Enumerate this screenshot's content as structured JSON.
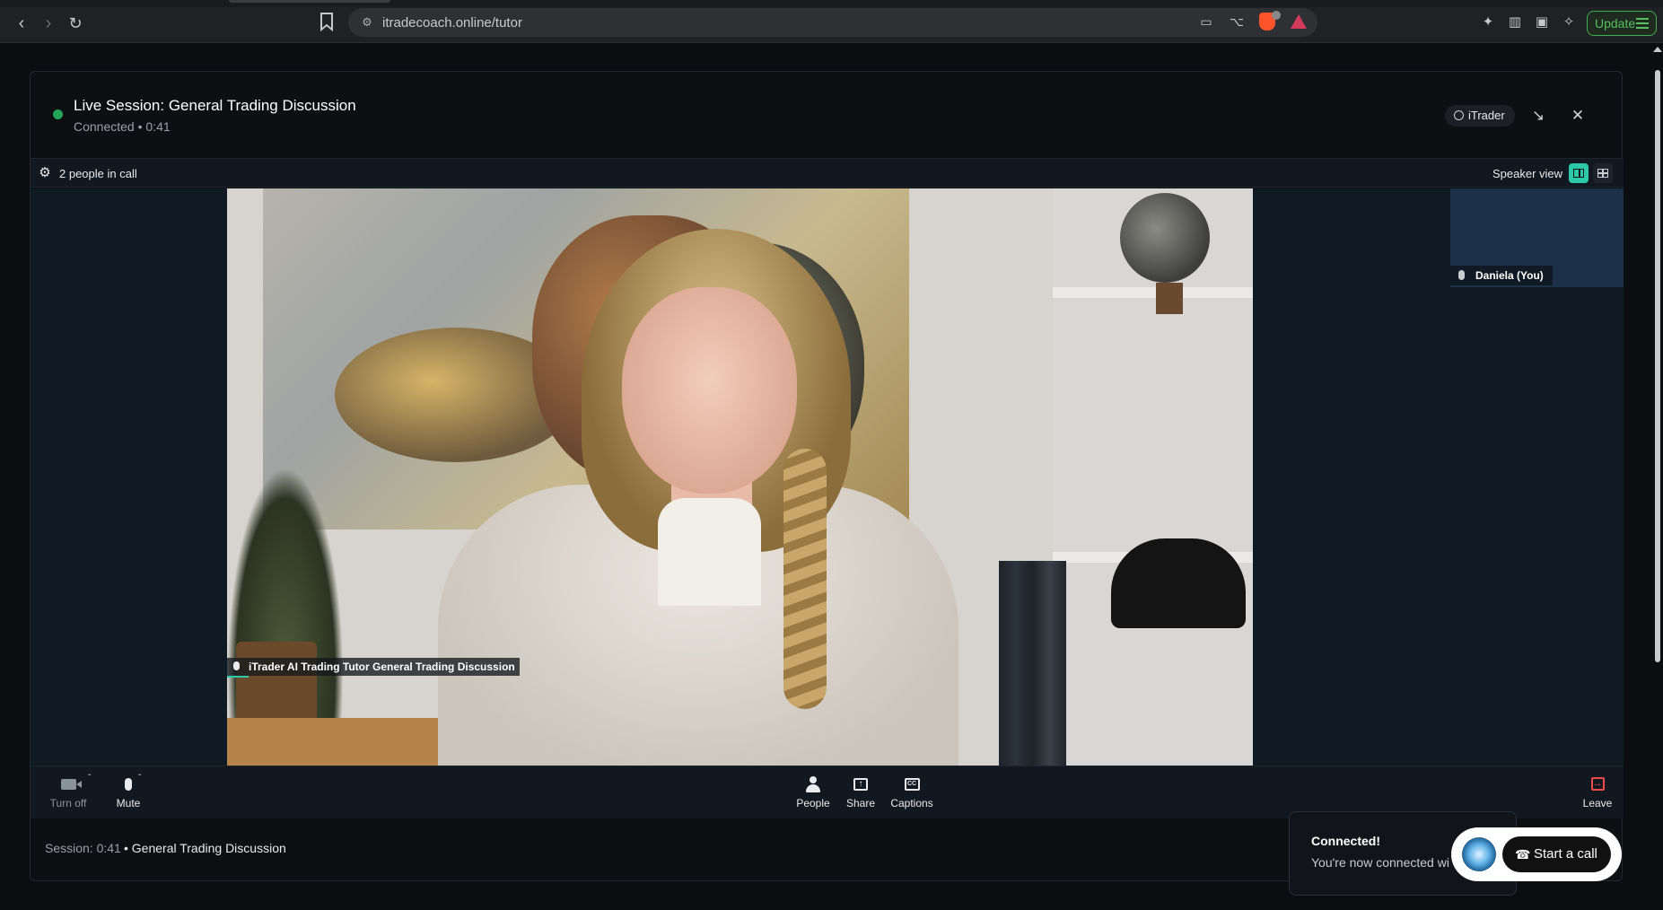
{
  "browser": {
    "url": "itradecoach.online/tutor",
    "update_label": "Update"
  },
  "modal": {
    "title": "Live Session: General Trading Discussion",
    "status": "Connected • 0:41",
    "assistant_badge": "iTrader",
    "people_count": "2 people in call",
    "view_label": "Speaker view",
    "main_participant": "iTrader AI Trading Tutor General Trading Discussion",
    "self_participant": "Daniela (You)",
    "controls": {
      "camera": "Turn off",
      "mic": "Mute",
      "people": "People",
      "share": "Share",
      "captions": "Captions",
      "leave": "Leave"
    },
    "footer": {
      "time": "Session: 0:41",
      "topic": "• General Trading Discussion"
    }
  },
  "toast": {
    "title": "Connected!",
    "message": "You're now connected wi"
  },
  "widget": {
    "start_call": "Start a call"
  },
  "colors": {
    "live": "#22a559",
    "accent": "#2bc9a8",
    "leave": "#f04c4c",
    "update": "#56c15d"
  }
}
